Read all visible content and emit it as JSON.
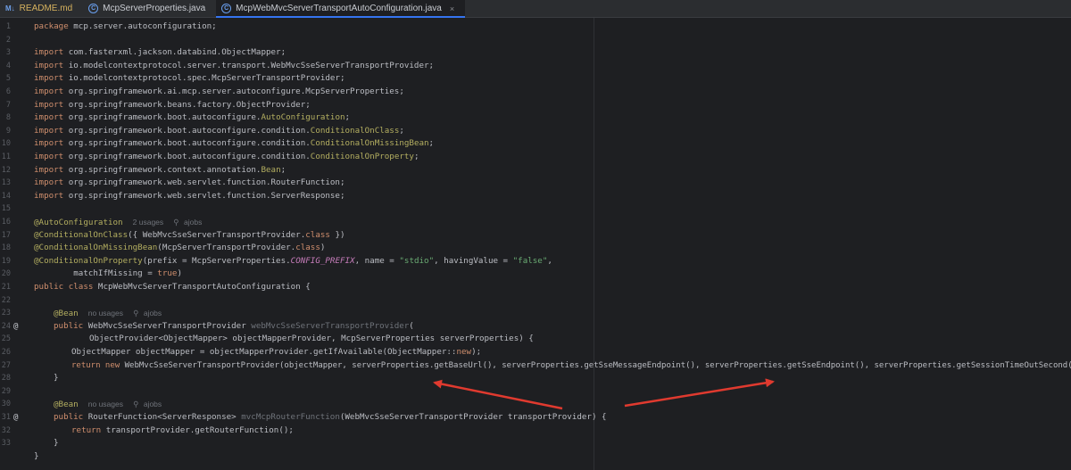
{
  "tabs": [
    {
      "icon": "M↓",
      "label": "README.md",
      "active": false
    },
    {
      "icon": "C",
      "label": "McpServerProperties.java",
      "active": false
    },
    {
      "icon": "C",
      "label": "McpWebMvcServerTransportAutoConfiguration.java",
      "active": true,
      "close": "×"
    }
  ],
  "code": {
    "line_numbers": [
      "1",
      "2",
      "3",
      "4",
      "5",
      "6",
      "7",
      "8",
      "9",
      "10",
      "11",
      "12",
      "13",
      "14",
      "15",
      "16",
      "17",
      "18",
      "19",
      "20",
      "21",
      "22",
      "23",
      "24",
      "25",
      "26",
      "27",
      "28",
      "29",
      "30",
      "31",
      "32",
      "33"
    ],
    "gutter_marker": "@",
    "l1": {
      "kw": "package",
      "rest": " mcp.server.autoconfiguration;"
    },
    "imports": [
      {
        "a": " com.fasterxml.jackson.databind.ObjectMapper;",
        "b": ""
      },
      {
        "a": " io.modelcontextprotocol.server.transport.WebMvcSseServerTransportProvider;",
        "b": ""
      },
      {
        "a": " io.modelcontextprotocol.spec.McpServerTransportProvider;",
        "b": ""
      },
      {
        "a": " org.springframework.ai.mcp.server.autoconfigure.McpServerProperties;",
        "b": ""
      },
      {
        "a": " org.springframework.beans.factory.ObjectProvider;",
        "b": ""
      },
      {
        "a": " org.springframework.boot.autoconfigure.",
        "b": "AutoConfiguration",
        "c": ";"
      },
      {
        "a": " org.springframework.boot.autoconfigure.condition.",
        "b": "ConditionalOnClass",
        "c": ";"
      },
      {
        "a": " org.springframework.boot.autoconfigure.condition.",
        "b": "ConditionalOnMissingBean",
        "c": ";"
      },
      {
        "a": " org.springframework.boot.autoconfigure.condition.",
        "b": "ConditionalOnProperty",
        "c": ";"
      },
      {
        "a": " org.springframework.context.annotation.",
        "b": "Bean",
        "c": ";"
      },
      {
        "a": " org.springframework.web.servlet.function.RouterFunction;",
        "b": ""
      },
      {
        "a": " org.springframework.web.servlet.function.ServerResponse;",
        "b": ""
      }
    ],
    "import_kw": "import",
    "l16": {
      "ann": "@AutoConfiguration",
      "hint1": "2 usages",
      "hint2": "ajobs"
    },
    "l17": {
      "ann": "@ConditionalOnClass",
      "a": "({ WebMvcSseServerTransportProvider.",
      "kw": "class",
      "b": " })"
    },
    "l18": {
      "ann": "@ConditionalOnMissingBean",
      "a": "(McpServerTransportProvider.",
      "kw": "class",
      "b": ")"
    },
    "l19": {
      "ann": "@ConditionalOnProperty",
      "a": "(prefix = McpServerProperties.",
      "st": "CONFIG_PREFIX",
      "b": ", name = ",
      "s1": "\"stdio\"",
      "c": ", havingValue = ",
      "s2": "\"false\"",
      "d": ","
    },
    "l20": {
      "a": "        matchIfMissing = ",
      "kw": "true",
      "b": ")"
    },
    "l21": {
      "kw": "public class",
      "rest": " McpWebMvcServerTransportAutoConfiguration {"
    },
    "l23": {
      "ann": "@Bean",
      "hint1": "no usages",
      "hint2": "ajobs"
    },
    "l24": {
      "kw": "public",
      "a": " WebMvcSseServerTransportProvider ",
      "gr": "webMvcSseServerTransportProvider",
      "b": "("
    },
    "l25": "ObjectProvider<ObjectMapper> objectMapperProvider, McpServerProperties serverProperties) {",
    "l26": {
      "a": "ObjectMapper objectMapper = objectMapperProvider.getIfAvailable(ObjectMapper::",
      "kw": "new",
      "b": ");"
    },
    "l27": {
      "kw": "return new",
      "rest": " WebMvcSseServerTransportProvider(objectMapper, serverProperties.getBaseUrl(), serverProperties.getSseMessageEndpoint(), serverProperties.getSseEndpoint(), serverProperties.getSessionTimeOutSecond());"
    },
    "l28": "}",
    "l30": {
      "ann": "@Bean",
      "hint1": "no usages",
      "hint2": "ajobs"
    },
    "l31": {
      "kw": "public",
      "a": " RouterFunction<ServerResponse> ",
      "gr": "mvcMcpRouterFunction",
      "b": "(WebMvcSseServerTransportProvider transportProvider) {"
    },
    "l32": {
      "kw": "return",
      "rest": " transportProvider.getRouterFunction();"
    },
    "l33": "}",
    "l34": "}"
  },
  "colors": {
    "background": "#1e1f22",
    "keyword": "#cf8e6d",
    "annotation": "#b3ae60",
    "string": "#6aab73",
    "arrow": "#e03a2f"
  }
}
